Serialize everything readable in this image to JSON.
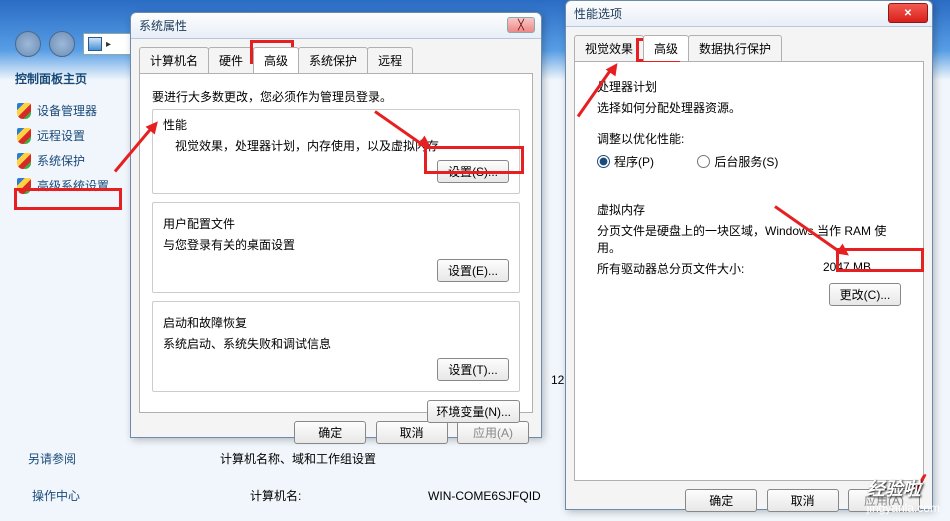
{
  "sidebar": {
    "title": "控制面板主页",
    "items": [
      {
        "label": "设备管理器"
      },
      {
        "label": "远程设置"
      },
      {
        "label": "系统保护"
      },
      {
        "label": "高级系统设置"
      }
    ],
    "see_also": "另请参阅",
    "operation": "操作中心"
  },
  "underpage": {
    "section": "计算机名称、域和工作组设置",
    "name_label": "计算机名:",
    "name_value": "WIN-COME6SJFQID",
    "cut_text": "12"
  },
  "dlg1": {
    "title": "系统属性",
    "close": "╳",
    "tabs": [
      "计算机名",
      "硬件",
      "高级",
      "系统保护",
      "远程"
    ],
    "active_tab": 2,
    "admin_hint": "要进行大多数更改，您必须作为管理员登录。",
    "perf_title": "性能",
    "perf_desc": "视觉效果，处理器计划，内存使用，以及虚拟内存",
    "btn_settings_s": "设置(S)...",
    "profile_title": "用户配置文件",
    "profile_desc": "与您登录有关的桌面设置",
    "btn_settings_e": "设置(E)...",
    "startup_title": "启动和故障恢复",
    "startup_desc": "系统启动、系统失败和调试信息",
    "btn_settings_t": "设置(T)...",
    "btn_env": "环境变量(N)...",
    "btn_ok": "确定",
    "btn_cancel": "取消",
    "btn_apply": "应用(A)"
  },
  "dlg2": {
    "title": "性能选项",
    "tabs": [
      "视觉效果",
      "高级",
      "数据执行保护"
    ],
    "active_tab": 1,
    "sched_title": "处理器计划",
    "sched_desc": "选择如何分配处理器资源。",
    "adjust_label": "调整以优化性能:",
    "radio_programs": "程序(P)",
    "radio_services": "后台服务(S)",
    "vm_title": "虚拟内存",
    "vm_desc": "分页文件是硬盘上的一块区域，Windows 当作 RAM 使用。",
    "vm_total_label": "所有驱动器总分页文件大小:",
    "vm_total_value": "2047 MB",
    "btn_change": "更改(C)...",
    "btn_ok": "确定",
    "btn_cancel": "取消",
    "btn_apply": "应用(A)"
  },
  "watermark": {
    "brand": "经验啦",
    "url": "jingyanla.com"
  }
}
